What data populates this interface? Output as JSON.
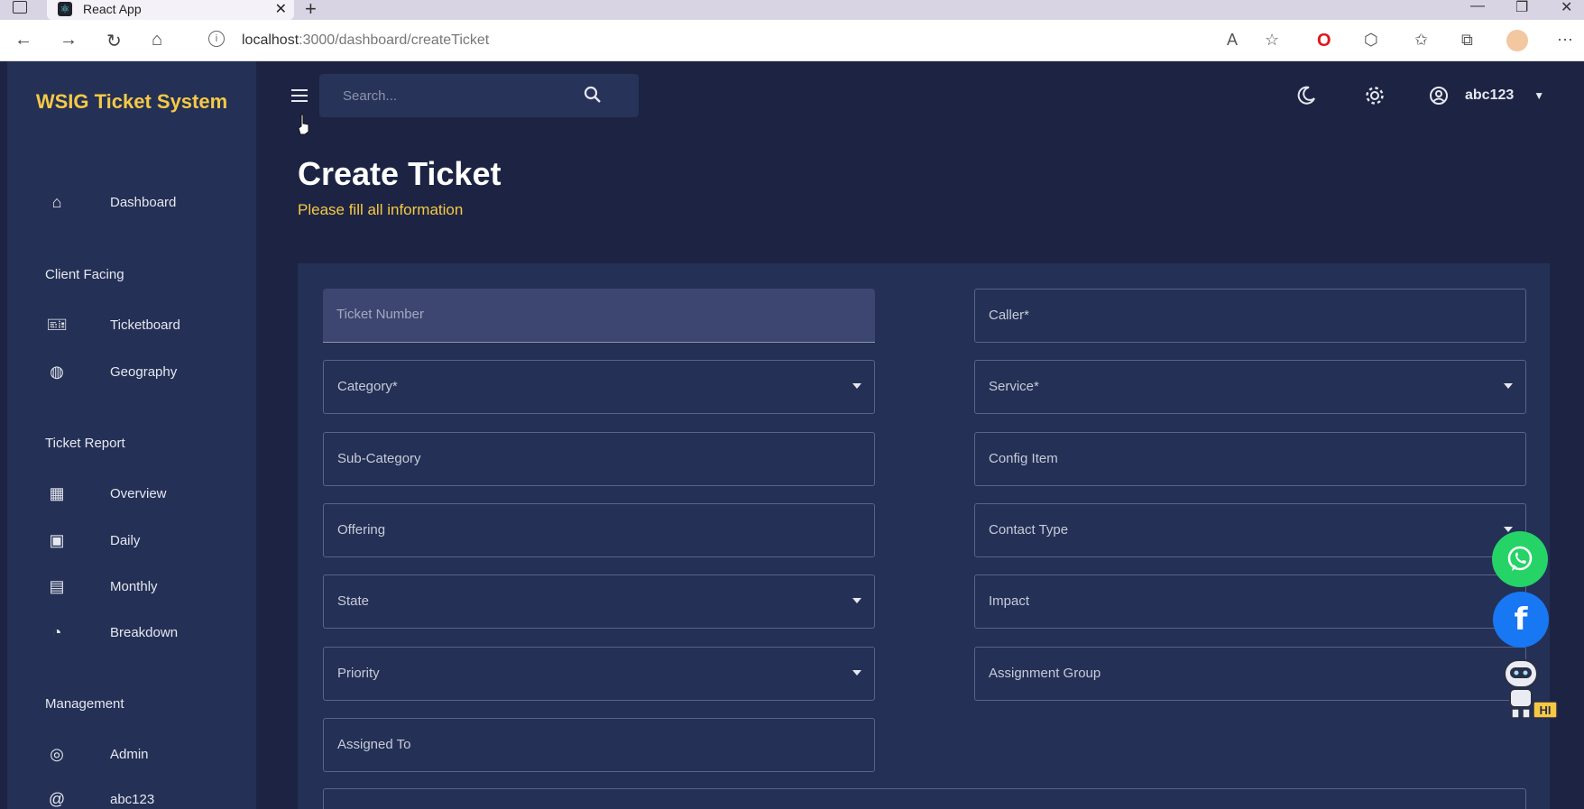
{
  "browser": {
    "tab_title": "React App",
    "url_host": "localhost",
    "url_rest": ":3000/dashboard/createTicket"
  },
  "sidebar": {
    "brand": "WSIG Ticket System",
    "items": [
      {
        "label": "Dashboard",
        "icon": "home-icon"
      },
      {
        "label": "Ticketboard",
        "icon": "ticket-icon"
      },
      {
        "label": "Geography",
        "icon": "globe-icon"
      },
      {
        "label": "Overview",
        "icon": "cash-register-icon"
      },
      {
        "label": "Daily",
        "icon": "calendar-icon"
      },
      {
        "label": "Monthly",
        "icon": "calendar-month-icon"
      },
      {
        "label": "Breakdown",
        "icon": "pie-chart-icon"
      },
      {
        "label": "Admin",
        "icon": "admin-icon"
      }
    ],
    "sections": [
      "Client Facing",
      "Ticket Report",
      "Management"
    ],
    "footer_label": "abc123"
  },
  "topbar": {
    "search_placeholder": "Search...",
    "username": "abc123"
  },
  "page": {
    "title": "Create Ticket",
    "subtitle": "Please fill all information"
  },
  "form": {
    "ticket_number": "Ticket Number",
    "caller": "Caller*",
    "category": "Category*",
    "service": "Service*",
    "sub_category": "Sub-Category",
    "config_item": "Config Item",
    "offering": "Offering",
    "contact_type": "Contact Type",
    "state": "State",
    "impact": "Impact",
    "priority": "Priority",
    "assignment_group": "Assignment Group",
    "assigned_to": "Assigned To"
  },
  "widgets": {
    "bot_badge": "HI"
  },
  "colors": {
    "background": "#1d2443",
    "sidebar": "#243055",
    "accent_yellow": "#f6c945",
    "whatsapp": "#25d366",
    "facebook": "#1877f2"
  }
}
